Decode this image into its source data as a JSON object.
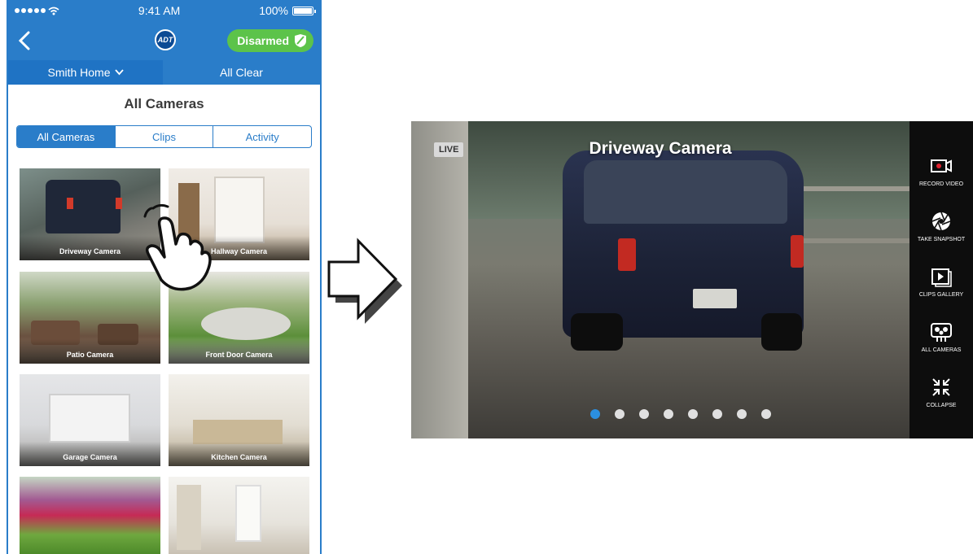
{
  "phone": {
    "status": {
      "time": "9:41 AM",
      "battery": "100%",
      "battery_level": 1.0
    },
    "nav": {
      "logo": "ADT",
      "arm_status": "Disarmed"
    },
    "location": {
      "name": "Smith Home",
      "status": "All Clear"
    },
    "section_title": "All Cameras",
    "tabs": [
      {
        "label": "All Cameras",
        "active": true
      },
      {
        "label": "Clips",
        "active": false
      },
      {
        "label": "Activity",
        "active": false
      }
    ],
    "cameras": [
      {
        "name": "Driveway Camera"
      },
      {
        "name": "Hallway Camera"
      },
      {
        "name": "Patio Camera"
      },
      {
        "name": "Front Door Camera"
      },
      {
        "name": "Garage Camera"
      },
      {
        "name": "Kitchen Camera"
      },
      {
        "name": ""
      },
      {
        "name": ""
      }
    ]
  },
  "player": {
    "live_badge": "LIVE",
    "title": "Driveway Camera",
    "page_count": 8,
    "active_page": 1,
    "controls": [
      {
        "label": "RECORD VIDEO",
        "icon": "record-video-icon"
      },
      {
        "label": "TAKE SNAPSHOT",
        "icon": "snapshot-icon"
      },
      {
        "label": "CLIPS GALLERY",
        "icon": "clips-gallery-icon"
      },
      {
        "label": "ALL CAMERAS",
        "icon": "all-cameras-icon"
      },
      {
        "label": "COLLAPSE",
        "icon": "collapse-icon"
      }
    ]
  },
  "colors": {
    "brand_blue": "#2a7dc9",
    "disarmed_green": "#5cc34a",
    "active_dot": "#2b8fe0"
  }
}
